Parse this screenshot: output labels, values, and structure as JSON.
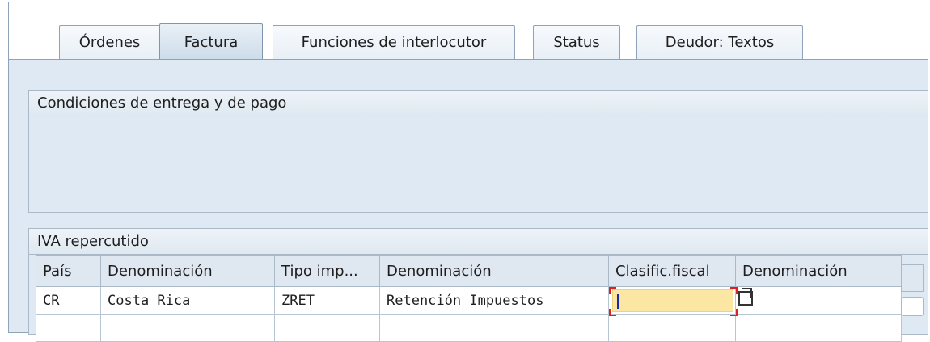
{
  "tabs": [
    {
      "label": "Órdenes",
      "active": false
    },
    {
      "label": "Factura",
      "active": true
    },
    {
      "label": "Funciones de interlocutor",
      "active": false
    },
    {
      "label": "Status",
      "active": false
    },
    {
      "label": "Deudor: Textos",
      "active": false
    }
  ],
  "delivery_group": {
    "title": "Condiciones de entrega y de pago"
  },
  "tax_group": {
    "title": "IVA repercutido",
    "columns": [
      "País",
      "Denominación",
      "Tipo imp...",
      "Denominación",
      "Clasific.fiscal",
      "Denominación"
    ],
    "rows": [
      {
        "pais": "CR",
        "denominacion": "Costa Rica",
        "tipo": "ZRET",
        "denominacion2": "Retención Impuestos",
        "clasif": "",
        "denominacion3": ""
      }
    ]
  },
  "colors": {
    "frame_bg": "#dfe9f3",
    "input_highlight": "#fbe7a3",
    "focus_corner": "#e02020"
  },
  "icons": [
    "value-help-icon",
    "row-selector"
  ]
}
